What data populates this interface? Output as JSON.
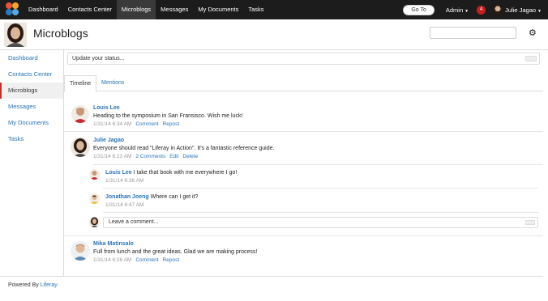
{
  "topbar": {
    "nav": [
      "Dashboard",
      "Contacts Center",
      "Microblogs",
      "Messages",
      "My Documents",
      "Tasks"
    ],
    "active_index": 2,
    "goto_label": "Go To",
    "admin_label": "Admin",
    "notification_count": "4",
    "user_name": "Julie Jagao"
  },
  "header": {
    "title": "Microblogs"
  },
  "sidebar": {
    "items": [
      "Dashboard",
      "Contacts Center",
      "Microblogs",
      "Messages",
      "My Documents",
      "Tasks"
    ],
    "active_index": 2
  },
  "status": {
    "placeholder": "Update your status..."
  },
  "tabs": {
    "timeline": "Timeline",
    "mentions": "Mentions"
  },
  "posts": [
    {
      "author": "Louis Lee",
      "message": "Heading to the symposium in San Fransisco. Wish me luck!",
      "timestamp": "1/31/14 6:34 AM",
      "actions": [
        "Comment",
        "Repost"
      ]
    },
    {
      "author": "Julie Jagao",
      "message": "Everyone should read \"Liferay in Action\". It's a fantastic reference guide.",
      "timestamp": "1/31/14 6:23 AM",
      "actions": [
        "2 Comments",
        "Edit",
        "Delete"
      ]
    },
    {
      "author": "Mika Matinsalo",
      "message": "Full from lunch and the great ideas. Glad we are making process!",
      "timestamp": "1/31/14 6:26 AM",
      "actions": [
        "Comment",
        "Repost"
      ]
    }
  ],
  "comments": [
    {
      "author": "Louis Lee",
      "message": "I take that book with me everywhere I go!",
      "timestamp": "1/31/14 6:36 AM"
    },
    {
      "author": "Jonathan Joeng",
      "message": "Where can I get it?",
      "timestamp": "1/31/14 6:47 AM"
    }
  ],
  "comment_input": {
    "placeholder": "Leave a comment..."
  },
  "footer": {
    "prefix": "Powered By",
    "link": "Liferay"
  },
  "colors": {
    "topbar_bg": "#1c1c1c",
    "link": "#2a74b8",
    "active_border": "#c9302c",
    "badge": "#c52020"
  }
}
